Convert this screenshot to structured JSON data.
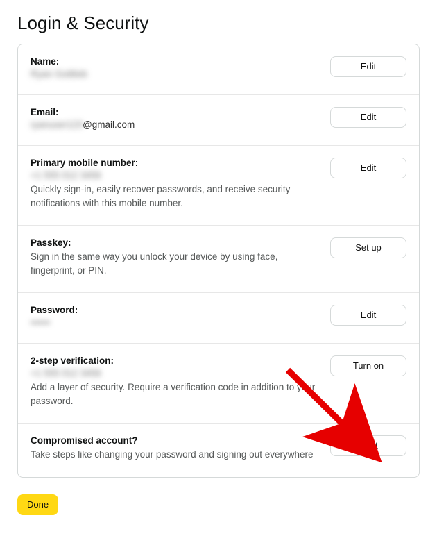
{
  "title": "Login & Security",
  "sections": {
    "name": {
      "label": "Name:",
      "value": "Ryan Gottlieb",
      "button": "Edit"
    },
    "email": {
      "label": "Email:",
      "value_hidden_part": "ryanuser123",
      "value_visible_part": "@gmail.com",
      "button": "Edit"
    },
    "phone": {
      "label": "Primary mobile number:",
      "value": "+1 555 012 3456",
      "desc": "Quickly sign-in, easily recover passwords, and receive security notifications with this mobile number.",
      "button": "Edit"
    },
    "passkey": {
      "label": "Passkey:",
      "desc": "Sign in the same way you unlock your device by using face, fingerprint, or PIN.",
      "button": "Set up"
    },
    "password": {
      "label": "Password:",
      "value": "••••••",
      "button": "Edit"
    },
    "twostep": {
      "label": "2-step verification:",
      "value": "+1 555 012 3456",
      "desc": "Add a layer of security. Require a verification code in addition to your password.",
      "button": "Turn on"
    },
    "compromised": {
      "label": "Compromised account?",
      "desc": "Take steps like changing your password and signing out everywhere",
      "button": "Start"
    }
  },
  "done_label": "Done",
  "annotation": {
    "arrow_color": "#e60000"
  }
}
